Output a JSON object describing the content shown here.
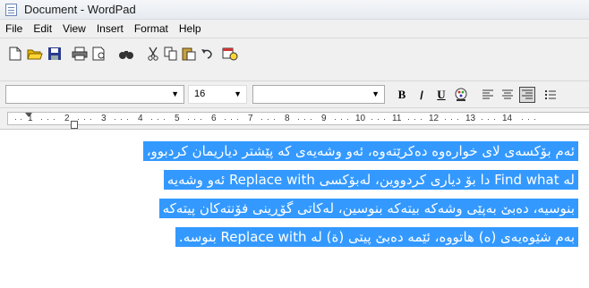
{
  "window": {
    "title": "Document - WordPad",
    "app_icon": "wordpad-document-icon"
  },
  "menu": [
    "File",
    "Edit",
    "View",
    "Insert",
    "Format",
    "Help"
  ],
  "toolbar": {
    "icons": [
      "new-icon",
      "open-icon",
      "save-icon",
      "print-icon",
      "print-preview-icon",
      "find-icon",
      "cut-icon",
      "copy-icon",
      "paste-icon",
      "undo-icon",
      "date-time-icon"
    ]
  },
  "format_bar": {
    "font_name": "",
    "font_size": "16",
    "script": "",
    "bold": "B",
    "italic": "/",
    "underline": "U",
    "color_icon": "font-color-icon",
    "align_icons": [
      "align-left-icon",
      "align-center-icon",
      "align-right-icon",
      "bullets-icon"
    ]
  },
  "ruler": {
    "numbers": [
      "1",
      "2",
      "3",
      "4",
      "5",
      "6",
      "7",
      "8",
      "9",
      "10",
      "11",
      "12",
      "13",
      "14"
    ]
  },
  "document": {
    "lines": [
      "ئەم بۆکسەی لای خوارەوە دەکرێتەوە، ئەو وشەیەی کە پێشتر دیاریمان کردبوو،",
      "لە Find what دا بۆ دیاری کردووین، لەبۆکسی Replace with ئەو وشەیە",
      "بنوسیە، دەبێ بەپێی وشەکە بیتەکە بنوسین، لەکاتی گۆڕینی فۆنتەکان پیتەکە",
      "بەم شێوەیەی (ه) هاتووە، ئێمە دەبێ پیتی (ة) لە Replace with بنوسە."
    ],
    "selection_color": "#3399ff"
  }
}
